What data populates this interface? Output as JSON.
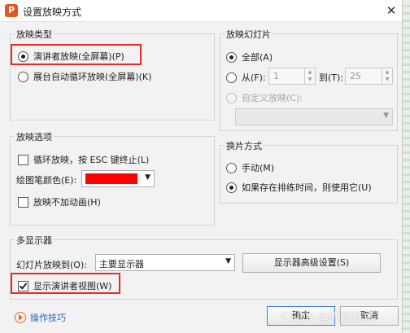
{
  "dialog": {
    "title": "设置放映方式",
    "logo": "P",
    "close_glyph": "✕"
  },
  "show_type": {
    "legend": "放映类型",
    "options": [
      {
        "label": "演讲者放映(全屏幕)(P)",
        "selected": true
      },
      {
        "label": "展台自动循环放映(全屏幕)(K)",
        "selected": false
      }
    ]
  },
  "slides": {
    "legend": "放映幻灯片",
    "all_label": "全部(A)",
    "from_label": "从(F):",
    "from_value": "1",
    "to_label": "到(T):",
    "to_value": "25",
    "custom_label": "自定义放映(C):",
    "custom_value": ""
  },
  "options": {
    "legend": "放映选项",
    "loop_label": "循环放映，按 ESC 键终止(L)",
    "loop_checked": false,
    "pen_color_label": "绘图笔颜色(E):",
    "pen_color": "#ff0000",
    "no_animation_label": "放映不加动画(H)",
    "no_animation_checked": false
  },
  "advance": {
    "legend": "换片方式",
    "manual_label": "手动(M)",
    "timing_label": "如果存在排练时间，则使用它(U)",
    "selected": "timing"
  },
  "monitors": {
    "legend": "多显示器",
    "show_on_label": "幻灯片放映到(O):",
    "show_on_value": "主要显示器",
    "advanced_button": "显示器高级设置(S)",
    "presenter_view_label": "显示演讲者视图(W)",
    "presenter_view_checked": true
  },
  "footer": {
    "tips_label": "操作技巧",
    "ok_label": "确定",
    "cancel_label": "取消"
  },
  "watermark": "CSDN @陈说技术",
  "icons": {
    "logo": "presentation-app-icon",
    "close": "close-icon",
    "tips": "play-tips-icon",
    "dropdown": "chevron-down-icon"
  }
}
